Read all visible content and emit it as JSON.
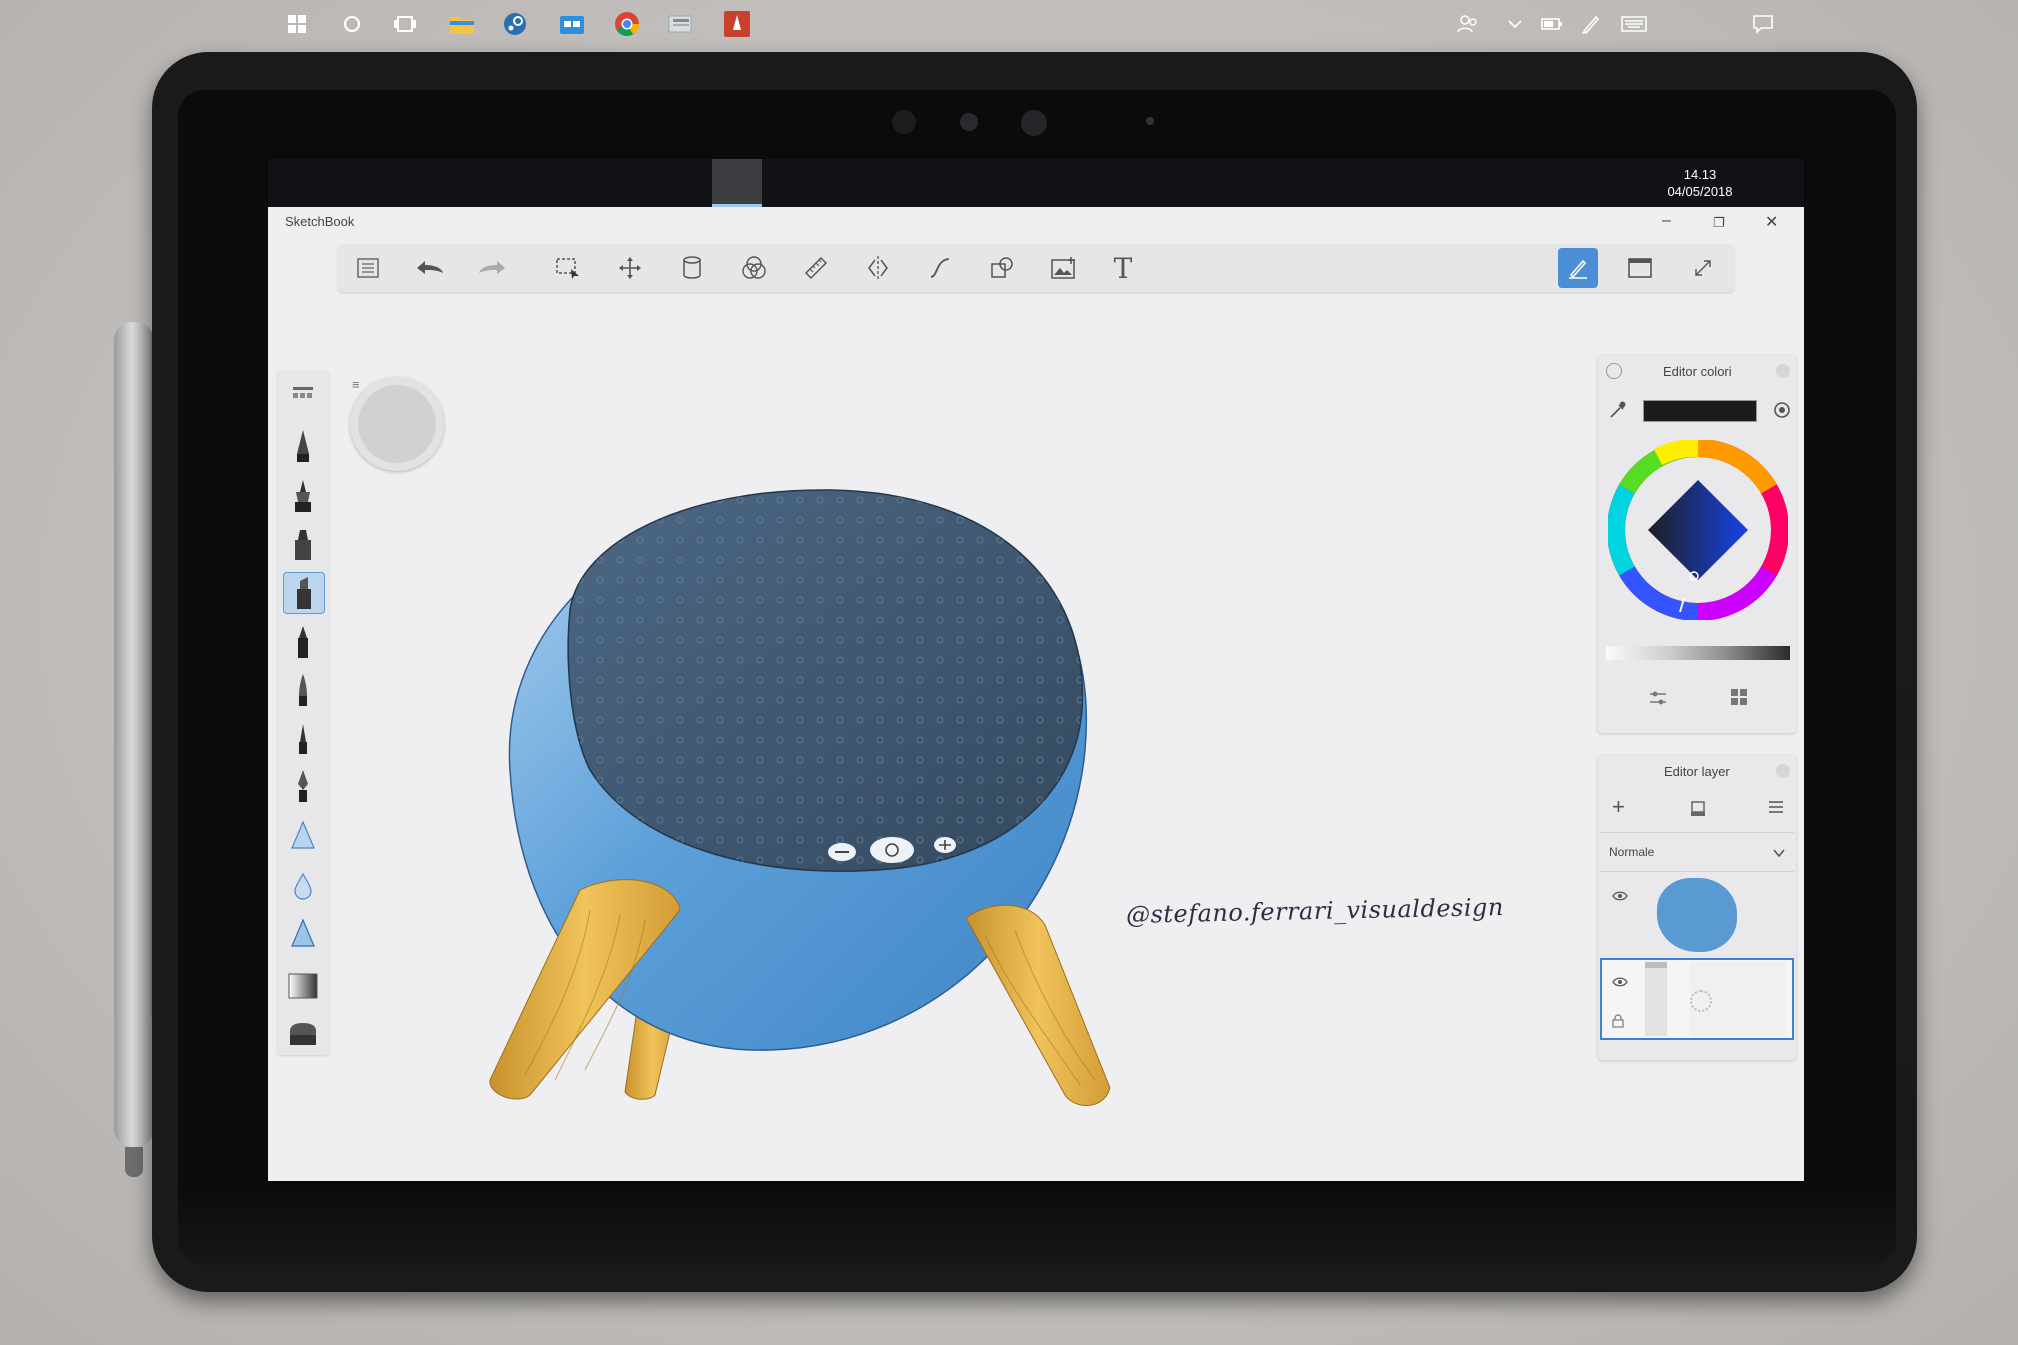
{
  "taskbar": {
    "icons": [
      "windows-start",
      "cortana",
      "task-view",
      "file-explorer",
      "steam",
      "store",
      "chrome",
      "news",
      "sketchbook"
    ],
    "tray": [
      "people-icon",
      "chevron-up-icon",
      "battery-icon",
      "pen-icon",
      "keyboard-icon",
      "notification-icon"
    ],
    "time": "14.13",
    "date": "04/05/2018"
  },
  "app": {
    "title": "SketchBook",
    "window_controls": [
      "–",
      "❐",
      "✕"
    ],
    "text_tool": "T"
  },
  "canvas": {
    "signature": "@stefano.ferrari_visualdesign"
  },
  "color_editor": {
    "title": "Editor colori",
    "current_color": "#1c1c1e"
  },
  "layer_editor": {
    "title": "Editor layer",
    "add_symbol": "+",
    "blend_mode": "Normale",
    "layers": [
      {
        "thumb_color": "#5a9ad2",
        "selected": false
      },
      {
        "thumb_color": "#f0f0f2",
        "selected": true
      }
    ]
  },
  "colors": {
    "accent": "#4a8fd6",
    "speaker_body": "#5ea3dc",
    "speaker_top": "#3f5b78",
    "wood": "#dcae45"
  }
}
